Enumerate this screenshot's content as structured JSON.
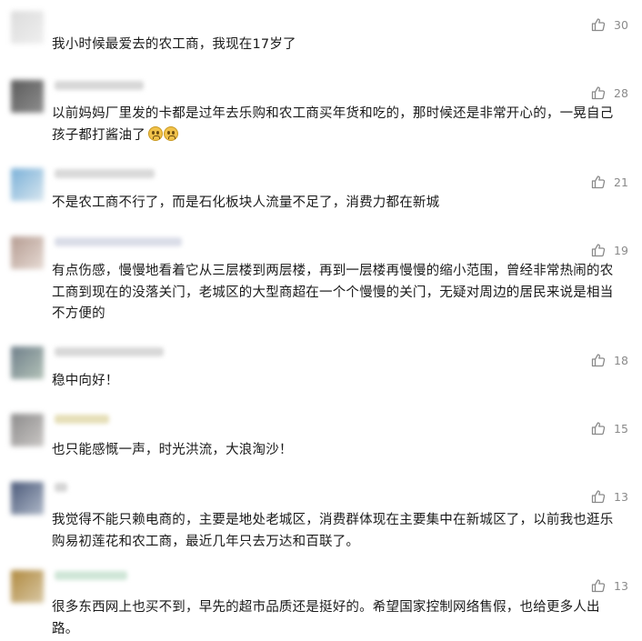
{
  "comments": [
    {
      "text_lines": [
        "我小时候最爱去的农工商，我现在17岁了"
      ],
      "likes": "30",
      "avatar_colors": [
        "#dcdcdc",
        "#efefef"
      ],
      "nick_color": "#e6e6e6",
      "nick_width": 0
    },
    {
      "text_lines": [
        "以前妈妈厂里发的卡都是过年去乐购和农工商买年货和吃的，那时候还是非常开心的，一晃自己",
        "孩子都打酱油了"
      ],
      "likes": "28",
      "avatar_colors": [
        "#5b5b5b",
        "#8e8e8e"
      ],
      "nick_color": "#d7d7d7",
      "nick_width": 98,
      "emoji": "😭😭"
    },
    {
      "text_lines": [
        "不是农工商不行了，而是石化板块人流量不足了，消费力都在新城"
      ],
      "likes": "21",
      "avatar_colors": [
        "#7ab0d8",
        "#d7e6ef"
      ],
      "nick_color": "#d9d9d9",
      "nick_width": 110
    },
    {
      "text_lines": [
        "有点伤感，慢慢地看着它从三层楼到两层楼，再到一层楼再慢慢的缩小范围，曾经非常热闹的农",
        "工商到现在的没落关门，老城区的大型商超在一个个慢慢的关门，无疑对周边的居民来说是相当",
        "不方便的"
      ],
      "likes": "19",
      "avatar_colors": [
        "#b59c92",
        "#e6dad3"
      ],
      "nick_color": "#dadde8",
      "nick_width": 140
    },
    {
      "text_lines": [
        "稳中向好！"
      ],
      "likes": "18",
      "avatar_colors": [
        "#6f7f8a",
        "#b3c2b8"
      ],
      "nick_color": "#d8d8d8",
      "nick_width": 120
    },
    {
      "text_lines": [
        "也只能感慨一声，时光洪流，大浪淘沙！"
      ],
      "likes": "15",
      "avatar_colors": [
        "#8d8c8c",
        "#c9c6c4"
      ],
      "nick_color": "#e6dfb8",
      "nick_width": 60
    },
    {
      "text_lines": [
        "我觉得不能只赖电商的，主要是地处老城区，消费群体现在主要集中在新城区了，以前我也逛乐",
        "购易初莲花和农工商，最近几年只去万达和百联了。"
      ],
      "likes": "13",
      "avatar_colors": [
        "#4c5a7a",
        "#aeb8c8"
      ],
      "nick_color": "#d5d5d5",
      "nick_width": 14
    },
    {
      "text_lines": [
        "很多东西网上也买不到，早先的超市品质还是挺好的。希望国家控制网络售假，也给更多人出",
        "路。"
      ],
      "likes": "13",
      "avatar_colors": [
        "#b08a40",
        "#d8c7a3"
      ],
      "nick_color": "#cfe6d7",
      "nick_width": 80
    }
  ],
  "icons": {
    "like": "thumbs-up-icon",
    "emoji": "crying-face-emoji"
  }
}
